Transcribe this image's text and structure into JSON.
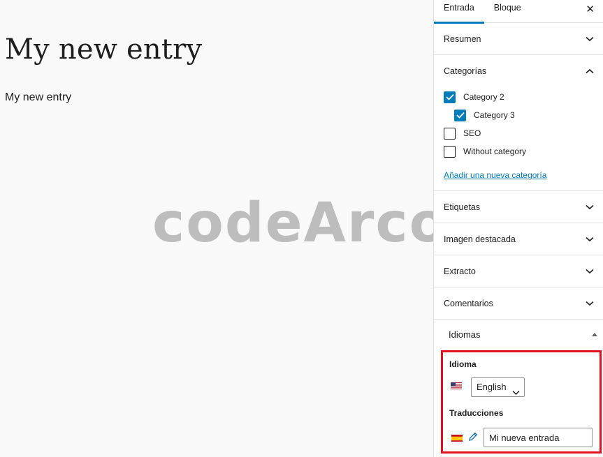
{
  "post": {
    "title": "My new entry",
    "body": "My new entry"
  },
  "watermark": "codeArco",
  "sidebar": {
    "tabs": [
      {
        "label": "Entrada",
        "active": true
      },
      {
        "label": "Bloque",
        "active": false
      }
    ],
    "close_icon": "close-icon",
    "panels": {
      "resumen": "Resumen",
      "categorias": "Categorías",
      "etiquetas": "Etiquetas",
      "imagen": "Imagen destacada",
      "extracto": "Extracto",
      "comentarios": "Comentarios"
    },
    "categories": [
      {
        "label": "Category 2",
        "checked": true,
        "child": false
      },
      {
        "label": "Category 3",
        "checked": true,
        "child": true
      },
      {
        "label": "SEO",
        "checked": false,
        "child": false
      },
      {
        "label": "Without category",
        "checked": false,
        "child": false
      }
    ],
    "add_category_link": "Añadir una nueva categoría",
    "languages": {
      "panel_title": "Idiomas",
      "language_label": "Idioma",
      "selected_language": "English",
      "translations_label": "Traducciones",
      "translation_value": "Mi nueva entrada"
    }
  },
  "colors": {
    "accent": "#007cba",
    "highlight": "#e3101f"
  }
}
